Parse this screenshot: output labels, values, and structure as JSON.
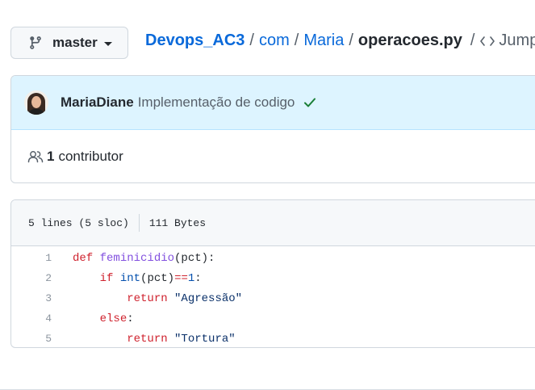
{
  "branch": {
    "label": "master"
  },
  "breadcrumb": {
    "repo": "Devops_AC3",
    "path": [
      "com",
      "Maria"
    ],
    "file": "operacoes.py",
    "jump_label": "Jump t"
  },
  "commit": {
    "author": "MariaDiane",
    "message": "Implementação de codigo",
    "status": "success"
  },
  "contributors": {
    "count": "1",
    "label": "contributor"
  },
  "file": {
    "lines_info": "5 lines (5 sloc)",
    "size": "111 Bytes",
    "code": [
      {
        "n": "1",
        "t": [
          {
            "c": "kw",
            "v": "def "
          },
          {
            "c": "fn",
            "v": "feminicidio"
          },
          {
            "c": "plain",
            "v": "(pct):"
          }
        ]
      },
      {
        "n": "2",
        "t": [
          {
            "c": "plain",
            "v": "    "
          },
          {
            "c": "kw",
            "v": "if "
          },
          {
            "c": "bi",
            "v": "int"
          },
          {
            "c": "plain",
            "v": "(pct)"
          },
          {
            "c": "kw",
            "v": "=="
          },
          {
            "c": "bi",
            "v": "1"
          },
          {
            "c": "plain",
            "v": ":"
          }
        ]
      },
      {
        "n": "3",
        "t": [
          {
            "c": "plain",
            "v": "        "
          },
          {
            "c": "kw",
            "v": "return "
          },
          {
            "c": "str",
            "v": "\"Agressão\""
          }
        ]
      },
      {
        "n": "4",
        "t": [
          {
            "c": "plain",
            "v": "    "
          },
          {
            "c": "kw",
            "v": "else"
          },
          {
            "c": "plain",
            "v": ":"
          }
        ]
      },
      {
        "n": "5",
        "t": [
          {
            "c": "plain",
            "v": "        "
          },
          {
            "c": "kw",
            "v": "return "
          },
          {
            "c": "str",
            "v": "\"Tortura\""
          }
        ]
      }
    ]
  },
  "colors": {
    "link": "#0969da",
    "success": "#1a7f37",
    "highlight_bg": "#ddf4ff"
  }
}
